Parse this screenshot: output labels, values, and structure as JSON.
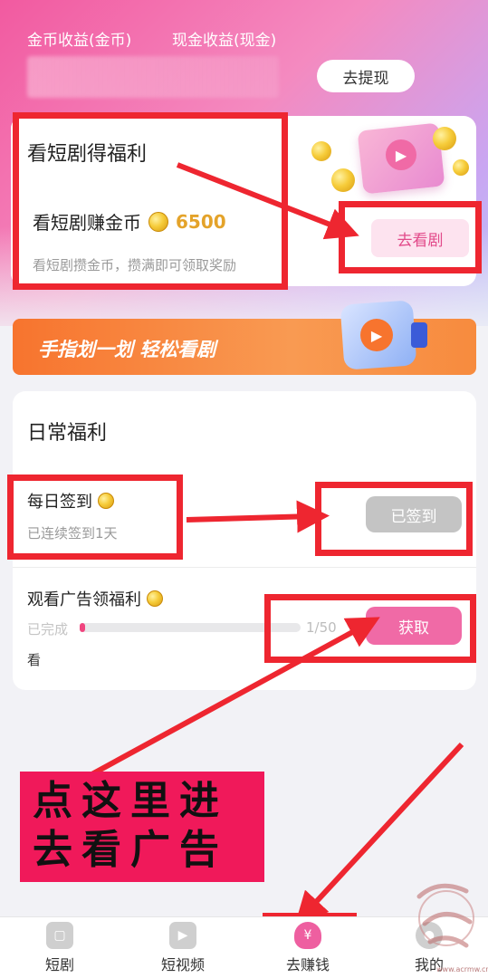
{
  "header": {
    "tab_coin_income": "金币收益(金币)",
    "tab_cash_income": "现金收益(现金)",
    "withdraw_label": "去提现"
  },
  "drama_card": {
    "title": "看短剧得福利",
    "subtitle": "看短剧赚金币",
    "coin_amount": "6500",
    "description": "看短剧攒金币，攒满即可领取奖励",
    "button_label": "去看剧"
  },
  "banner": {
    "text": "手指划一划 轻松看剧"
  },
  "daily": {
    "title": "日常福利",
    "checkin": {
      "title": "每日签到",
      "subtitle": "已连续签到1天",
      "button_label": "已签到"
    },
    "ad": {
      "title": "观看广告领福利",
      "completed_label": "已完成",
      "progress_text": "1/50",
      "progress_fraction": 0.02,
      "extra_text": "看",
      "button_label": "获取"
    }
  },
  "callout": {
    "line1": "点这里进",
    "line2": "去看广告"
  },
  "bottom_nav": {
    "items": [
      {
        "label": "短剧",
        "icon": "drama-icon"
      },
      {
        "label": "短视频",
        "icon": "video-icon"
      },
      {
        "label": "去赚钱",
        "icon": "money-bag-icon",
        "active": true
      },
      {
        "label": "我的",
        "icon": "profile-icon"
      }
    ]
  },
  "watermark": {
    "text": "www.acrmw.cn"
  },
  "colors": {
    "accent_pink": "#f06aa6",
    "highlight_red": "#ee2630",
    "banner_orange": "#f7742e",
    "coin_gold": "#e4a32a"
  }
}
